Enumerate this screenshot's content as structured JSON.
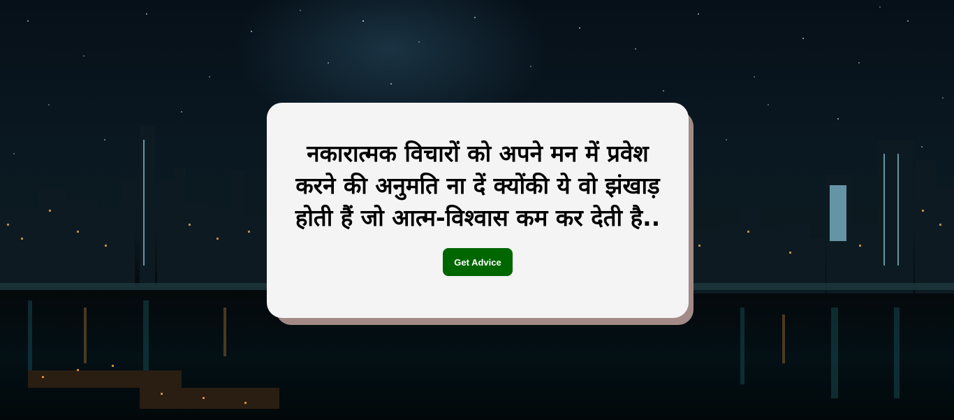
{
  "advice": {
    "text": "नकारात्मक विचारों को अपने मन में प्रवेश करने की अनुमति ना दें क्योंकी ये वो झंखाड़ होती हैं जो आत्म-विश्वास कम कर देती है..",
    "button_label": "Get Advice"
  },
  "colors": {
    "card_background": "#f4f4f4",
    "card_shadow": "#a38a86",
    "button_background": "#006600",
    "button_text": "#ffffff"
  }
}
